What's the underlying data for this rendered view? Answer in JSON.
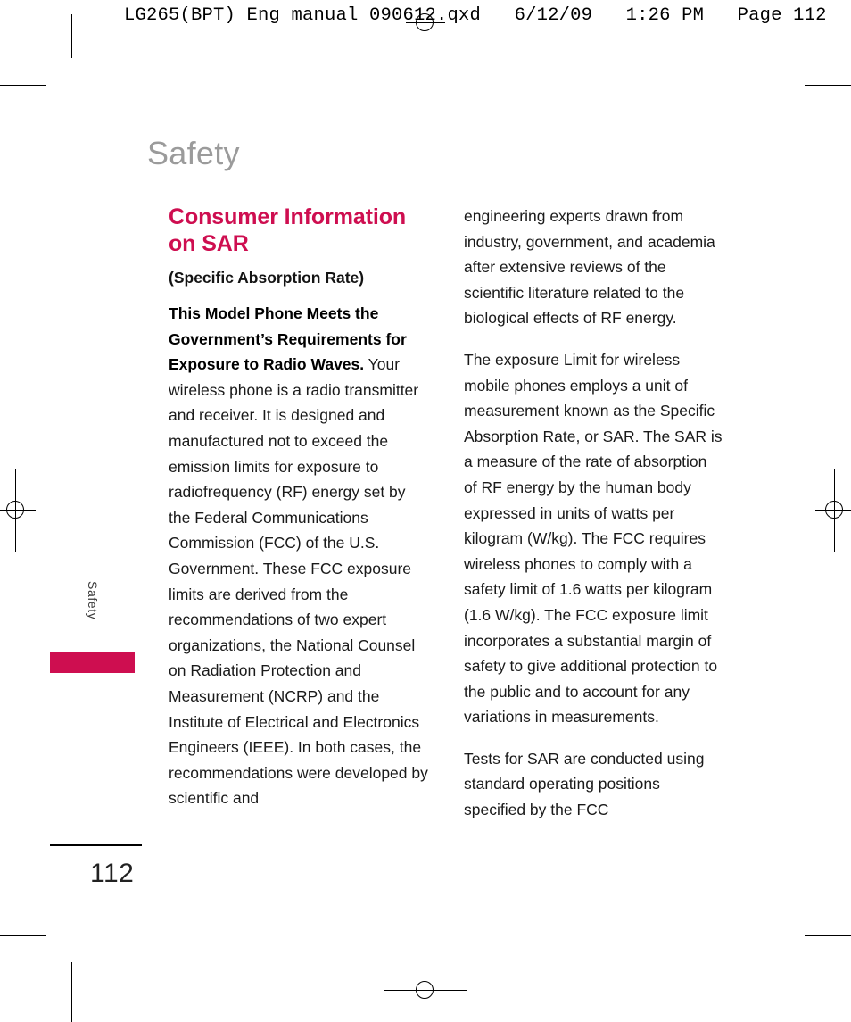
{
  "prepress": {
    "slug": "LG265(BPT)_Eng_manual_090612.qxd   6/12/09   1:26 PM   Page 112"
  },
  "colors": {
    "accent": "#CE0E50",
    "title_gray": "#9B9B9B",
    "body": "#1A1A1A"
  },
  "page": {
    "running_title": "Safety",
    "side_tab_label": "Safety",
    "folio": "112"
  },
  "content": {
    "section_heading": "Consumer Information on SAR",
    "sub_heading": "(Specific Absorption Rate)",
    "left_column": {
      "para1_bold": "This Model Phone Meets the Government’s Requirements for Exposure to Radio Waves.",
      "para1_rest": " Your wireless phone is a radio transmitter and receiver. It is designed and manufactured not to exceed the emission limits for exposure to radiofrequency (RF) energy set by the Federal Communications Commission (FCC) of the U.S. Government. These FCC exposure limits are derived from the recommendations of two expert organizations, the National Counsel on Radiation Protection and Measurement (NCRP) and the Institute of Electrical and Electronics Engineers (IEEE). In both cases, the recommendations were developed by scientific and"
    },
    "right_column": {
      "para1": "engineering experts drawn from industry, government, and academia after extensive reviews of the scientific literature related to the biological effects of RF energy.",
      "para2": "The exposure Limit for wireless mobile phones employs a unit of measurement known as the Specific Absorption Rate, or SAR. The SAR is a measure of the rate of absorption of RF energy by the human body expressed in units of watts per kilogram (W/kg). The FCC requires wireless phones to comply with a safety limit of 1.6 watts per kilogram (1.6 W/kg). The FCC exposure limit incorporates a substantial margin of safety to give additional protection to the public and to account for any variations in measurements.",
      "para3": "Tests for SAR are conducted using standard operating positions specified by the FCC"
    }
  }
}
